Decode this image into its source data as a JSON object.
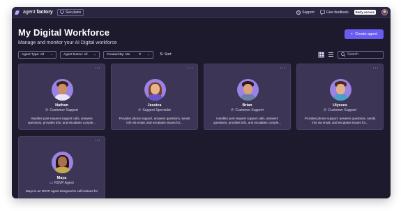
{
  "app": {
    "brand_light": "agent",
    "brand_bold": "factory",
    "see_plans": "See plans",
    "support": "Support",
    "give_feedback": "Give feedback",
    "early_access": "Early access"
  },
  "page": {
    "title": "My Digital Workforce",
    "subtitle": "Manage and monitor your AI Digital workforce",
    "create_agent": "Create agent"
  },
  "filters": {
    "agent_type": "Agent Type: All",
    "agent_name": "Agent Name: All",
    "created_by": "Created By: Me",
    "sort": "Sort",
    "search_placeholder": "Search"
  },
  "agents": [
    {
      "name": "Nathan",
      "role": "Customer Support",
      "description": "Handles post-request support calls, answers questions, provides info, and escalates comple..."
    },
    {
      "name": "Jessica",
      "role": "Support Specialist",
      "description": "Provides phone support, answers questions, sends info via email, and escalates issues for..."
    },
    {
      "name": "Brian",
      "role": "Customer Support",
      "description": "Handles post-request support calls, answers questions, provides info, and escalates comple..."
    },
    {
      "name": "Ulysses",
      "role": "Customer Support",
      "description": "Provides phone support, answers questions, sends info via email, and escalates issues for..."
    },
    {
      "name": "Maya",
      "role": "RSVP Agent",
      "description": "Maya is an RSVP agent designed to call invitees for"
    }
  ],
  "colors": {
    "background": "#1e1a2e",
    "card": "#3d3555",
    "accent": "#6a5cf0"
  }
}
